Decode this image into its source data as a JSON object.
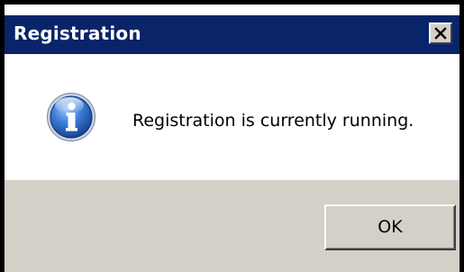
{
  "window": {
    "title": "Registration",
    "close_icon": "close-icon",
    "colors": {
      "titlebar": "#0a246a",
      "face": "#d4d0c8"
    }
  },
  "message": {
    "icon": "information-icon",
    "text": "Registration is currently running."
  },
  "buttons": {
    "ok_label": "OK"
  }
}
